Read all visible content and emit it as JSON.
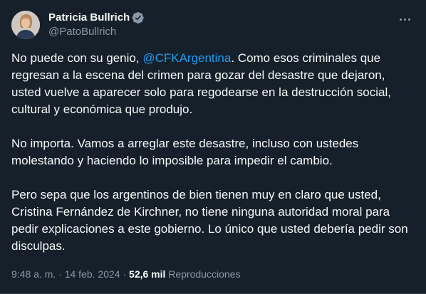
{
  "tweet": {
    "author": {
      "display_name": "Patricia Bullrich",
      "handle": "@PatoBullrich",
      "verified": true,
      "verified_icon": "verified-badge-icon",
      "avatar_icon": "user-avatar"
    },
    "more_icon": "more-options-icon",
    "paragraphs": [
      {
        "pre_mention": "No puede con su genio, ",
        "mention": "@CFKArgentina",
        "post_mention": ". Como esos criminales que regresan a la escena del crimen para gozar del desastre que dejaron, usted vuelve a aparecer solo para regodearse en la destrucción social, cultural y económica que produjo."
      },
      {
        "text": "No importa. Vamos a arreglar este desastre, incluso con ustedes molestando y haciendo lo imposible para impedir el cambio."
      },
      {
        "text": "Pero sepa que los argentinos de bien tienen muy en claro que usted, Cristina Fernández de Kirchner, no tiene ninguna autoridad moral para pedir explicaciones a este gobierno. Lo único que usted debería pedir son disculpas."
      }
    ],
    "meta": {
      "time": "9:48 a. m.",
      "separator": " · ",
      "date": "14 feb. 2024",
      "views_count": "52,6 mil",
      "views_label": "Reproducciones"
    }
  },
  "colors": {
    "background": "#15202b",
    "text": "#f7f9f9",
    "secondary_text": "#8b98a5",
    "accent": "#1d9bf0"
  }
}
